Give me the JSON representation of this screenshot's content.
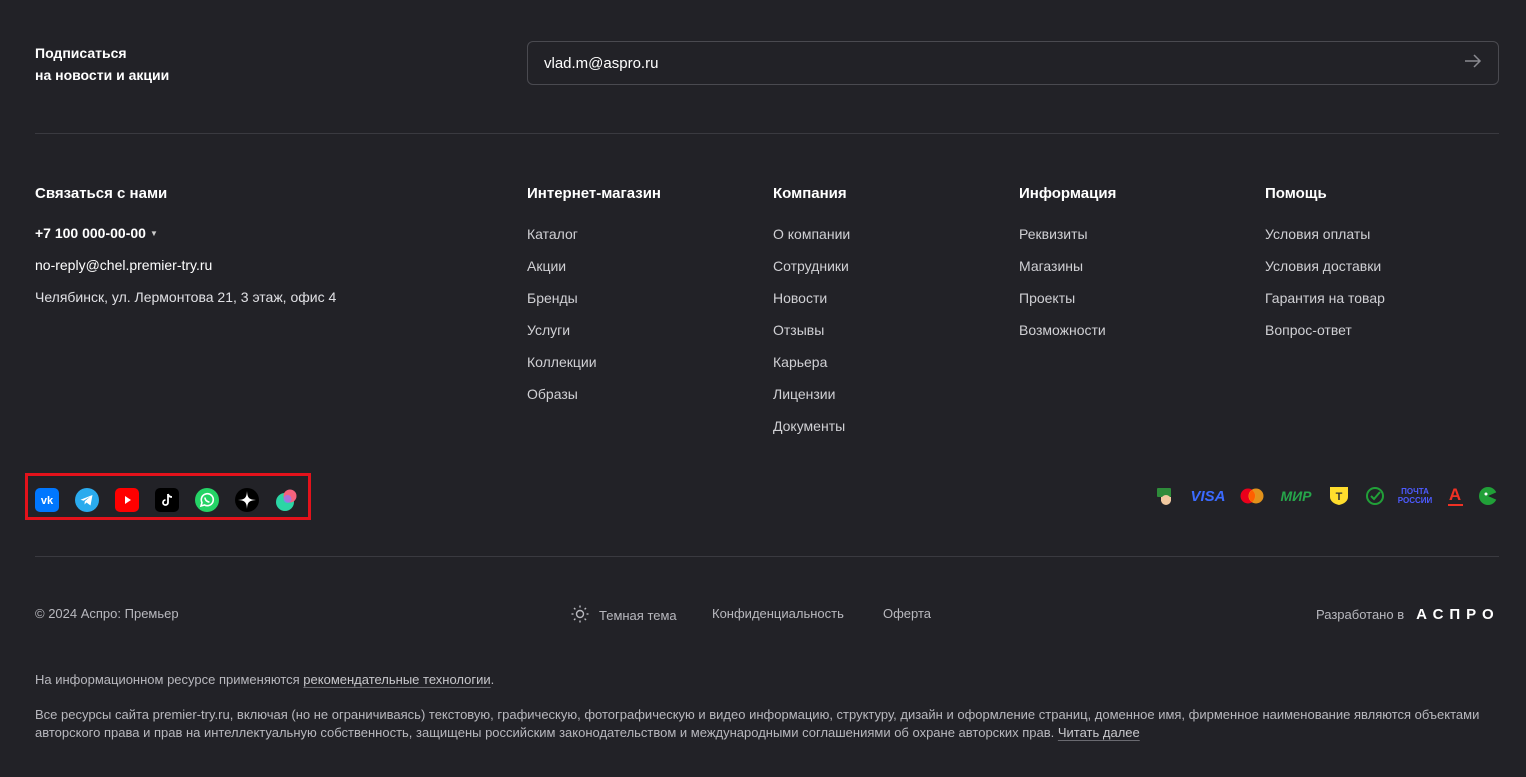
{
  "subscribe": {
    "title_line1": "Подписаться",
    "title_line2": "на новости и акции",
    "email_value": "vlad.m@aspro.ru",
    "submit_icon": "arrow-right-icon"
  },
  "contacts": {
    "title": "Связаться с нами",
    "phone": "+7 100 000-00-00",
    "email": "no-reply@chel.premier-try.ru",
    "address": "Челябинск, ул. Лермонтова 21, 3 этаж, офис 4"
  },
  "columns": [
    {
      "title": "Интернет-магазин",
      "items": [
        "Каталог",
        "Акции",
        "Бренды",
        "Услуги",
        "Коллекции",
        "Образы"
      ]
    },
    {
      "title": "Компания",
      "items": [
        "О компании",
        "Сотрудники",
        "Новости",
        "Отзывы",
        "Карьера",
        "Лицензии",
        "Документы"
      ]
    },
    {
      "title": "Информация",
      "items": [
        "Реквизиты",
        "Магазины",
        "Проекты",
        "Возможности"
      ]
    },
    {
      "title": "Помощь",
      "items": [
        "Условия оплаты",
        "Условия доставки",
        "Гарантия на товар",
        "Вопрос-ответ"
      ]
    }
  ],
  "social": [
    "vk-icon",
    "telegram-icon",
    "youtube-icon",
    "tiktok-icon",
    "whatsapp-icon",
    "zen-icon",
    "odnoklassniki-icon"
  ],
  "payments": {
    "visa": "VISA",
    "mir": "МИР",
    "pochta_line1": "ПОЧТА",
    "pochta_line2": "РОССИИ",
    "alfa": "А",
    "tinkoff": "Т"
  },
  "bottom": {
    "copyright": "© 2024 Аспро: Премьер",
    "theme_label": "Темная тема",
    "privacy": "Конфиденциальность",
    "offer": "Оферта",
    "developed_by": "Разработано в",
    "developer_logo": "АСПРО"
  },
  "legal": {
    "line1_text": "На информационном ресурсе применяются ",
    "line1_link": "рекомендательные технологии",
    "line1_end": ".",
    "line2_text": "Все ресурсы сайта premier-try.ru, включая (но не ограничиваясь) текстовую, графическую, фотографическую и видео информацию, структуру, дизайн и оформление страниц, доменное имя, фирменное наименование являются объектами авторского права и прав на интеллектуальную собственность, защищены российским законодательством и международными соглашениями об охране авторских прав. ",
    "line2_link": "Читать далее"
  },
  "colors": {
    "background": "#222227",
    "divider": "#3a3a40",
    "highlight_border": "#e3121b"
  }
}
